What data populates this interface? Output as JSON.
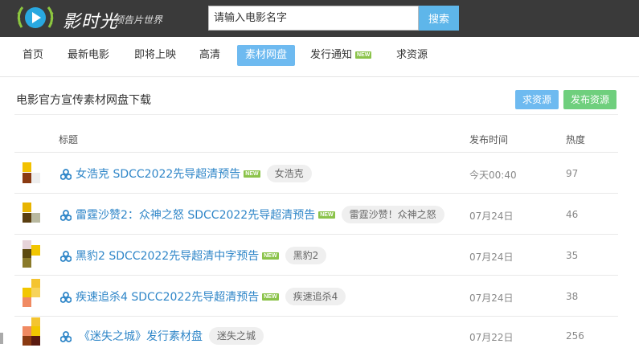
{
  "header": {
    "brand": "影时光",
    "tagline": "预告片世界",
    "search_placeholder": "请输入电影名字",
    "search_button": "搜索"
  },
  "nav": {
    "items": [
      {
        "label": "首页"
      },
      {
        "label": "最新电影"
      },
      {
        "label": "即将上映"
      },
      {
        "label": "高清"
      },
      {
        "label": "素材网盘",
        "active": true
      },
      {
        "label": "发行通知",
        "badge": "NEW"
      },
      {
        "label": "求资源"
      }
    ]
  },
  "section": {
    "title": "电影官方宣传素材网盘下载",
    "request_button": "求资源",
    "publish_button": "发布资源"
  },
  "table": {
    "columns": {
      "title": "标题",
      "date": "发布时间",
      "heat": "热度"
    },
    "rows": [
      {
        "title": "女浩克 SDCC2022先导超清预告",
        "badge": "NEW",
        "tag": "女浩克",
        "date": "今天00:40",
        "heat": "97"
      },
      {
        "title": "雷霆沙赞2：众神之怒 SDCC2022先导超清预告",
        "badge": "NEW",
        "tag": "雷霆沙赞！众神之怒",
        "date": "07月24日",
        "heat": "46"
      },
      {
        "title": "黑豹2 SDCC2022先导超清中字预告",
        "badge": "NEW",
        "tag": "黑豹2",
        "date": "07月24日",
        "heat": "35"
      },
      {
        "title": "疾速追杀4 SDCC2022先导超清预告",
        "badge": "NEW",
        "tag": "疾速追杀4",
        "date": "07月24日",
        "heat": "38"
      },
      {
        "title": "《迷失之城》发行素材盘",
        "badge": "",
        "tag": "迷失之城",
        "date": "07月22日",
        "heat": "256"
      }
    ]
  },
  "colors": {
    "header_bg": "#3a3a3a",
    "accent_blue": "#6ebaf0",
    "accent_green": "#6fcf7d",
    "link": "#2f86c8",
    "badge_green": "#8bc34a"
  }
}
